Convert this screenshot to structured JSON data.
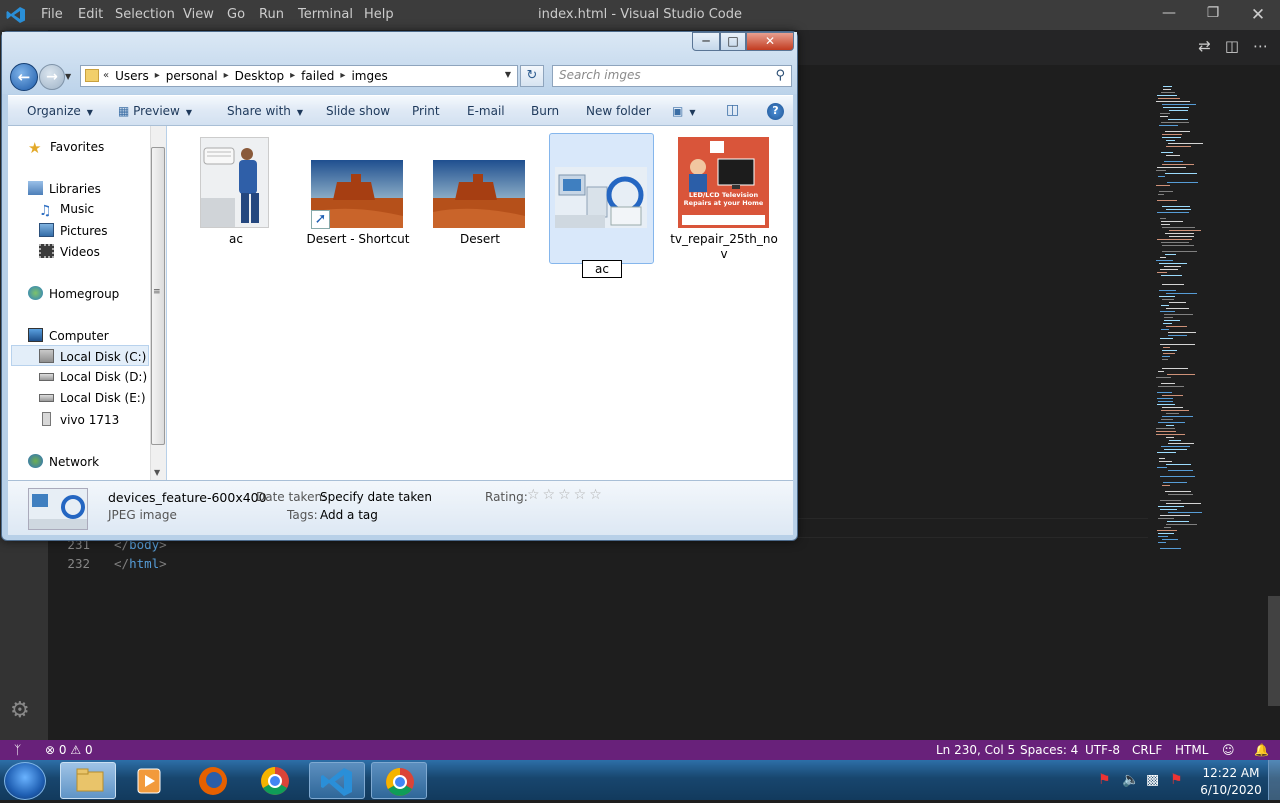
{
  "vscode": {
    "menu": [
      "File",
      "Edit",
      "Selection",
      "View",
      "Go",
      "Run",
      "Terminal",
      "Help"
    ],
    "window_title": "index.html - Visual Studio Code",
    "code_lines": [
      {
        "num": "231",
        "tag": "body"
      },
      {
        "num": "232",
        "tag": "html"
      }
    ],
    "status": {
      "errors": "0",
      "warnings": "0",
      "position": "Ln 230, Col 5",
      "spaces": "Spaces: 4",
      "encoding": "UTF-8",
      "eol": "CRLF",
      "language": "HTML"
    },
    "accent_color": "#68217a"
  },
  "explorer": {
    "breadcrumbs": [
      "Users",
      "personal",
      "Desktop",
      "failed",
      "imges"
    ],
    "search_placeholder": "Search imges",
    "commands": {
      "organize": "Organize",
      "preview": "Preview",
      "share_with": "Share with",
      "slide_show": "Slide show",
      "print": "Print",
      "email": "E-mail",
      "burn": "Burn",
      "new_folder": "New folder"
    },
    "nav": {
      "favorites": "Favorites",
      "libraries": "Libraries",
      "music": "Music",
      "pictures": "Pictures",
      "videos": "Videos",
      "homegroup": "Homegroup",
      "computer": "Computer",
      "disk_c": "Local Disk (C:)",
      "disk_d": "Local Disk (D:)",
      "disk_e": "Local Disk (E:)",
      "vivo": "vivo 1713",
      "network": "Network"
    },
    "files": [
      {
        "name": "ac",
        "kind": "photo-technician"
      },
      {
        "name": "Desert - Shortcut",
        "kind": "desert-shortcut"
      },
      {
        "name": "Desert",
        "kind": "desert"
      },
      {
        "name": "ac",
        "kind": "devices",
        "selected": true,
        "renaming": true
      },
      {
        "name": "tv_repair_25th_nov",
        "kind": "tv-poster"
      }
    ],
    "tv_poster": {
      "line1": "LED/LCD Television",
      "line2": "Repairs at your Home"
    },
    "details": {
      "filename": "devices_feature-600x400",
      "filetype": "JPEG image",
      "date_label": "Date taken:",
      "date_value": "Specify date taken",
      "tags_label": "Tags:",
      "tags_value": "Add a tag",
      "rating_label": "Rating:",
      "rating_value": 0,
      "stars": "☆☆☆☆☆"
    }
  },
  "taskbar": {
    "time": "12:22 AM",
    "date": "6/10/2020"
  }
}
